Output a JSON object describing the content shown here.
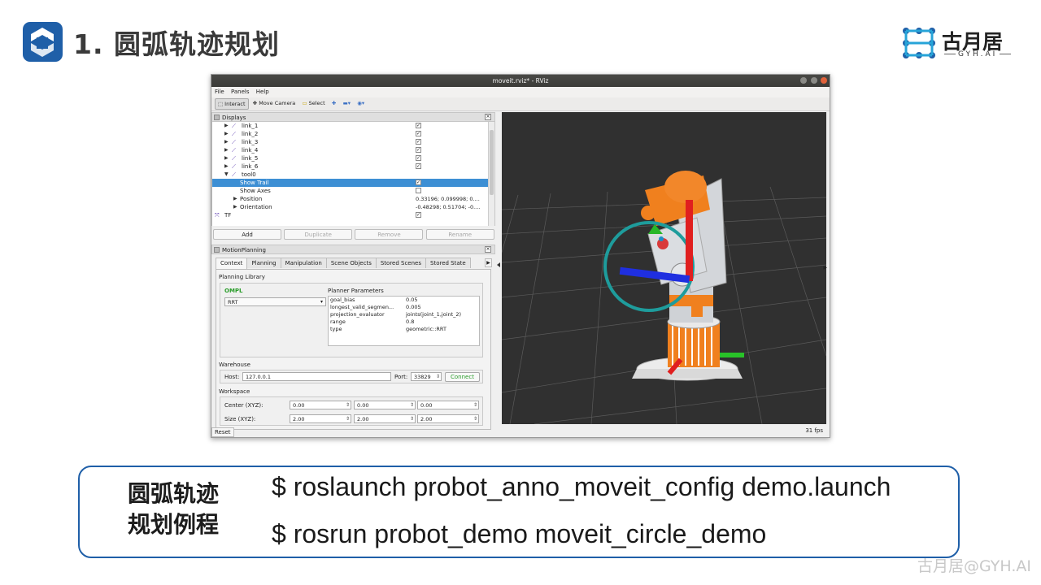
{
  "slide": {
    "title": "1. 圆弧轨迹规划",
    "brand_name": "古月居",
    "brand_sub": "GYH.AI",
    "watermark": "古月居@GYH.AI",
    "accent_color": "#1f5fa8"
  },
  "window": {
    "title": "moveit.rviz* - RViz",
    "menu": [
      "File",
      "Panels",
      "Help"
    ],
    "toolbar": {
      "interact": "Interact",
      "move_camera": "Move Camera",
      "select": "Select"
    },
    "fps": "31 fps",
    "reset": "Reset"
  },
  "displays": {
    "title": "Displays",
    "rows": [
      {
        "label": "link_1",
        "check": "✓"
      },
      {
        "label": "link_2",
        "check": "✓"
      },
      {
        "label": "link_3",
        "check": "✓"
      },
      {
        "label": "link_4",
        "check": "✓"
      },
      {
        "label": "link_5",
        "check": "✓"
      },
      {
        "label": "link_6",
        "check": "✓"
      },
      {
        "label": "tool0",
        "check": ""
      },
      {
        "label": "Show Trail",
        "check": "✓"
      },
      {
        "label": "Show Axes",
        "check": ""
      },
      {
        "label": "Position",
        "value": "0.33196; 0.099998; 0...."
      },
      {
        "label": "Orientation",
        "value": "-0.48298; 0.51704; -0...."
      },
      {
        "label": "TF",
        "check": "✓"
      }
    ],
    "buttons": [
      "Add",
      "Duplicate",
      "Remove",
      "Rename"
    ]
  },
  "motion": {
    "title": "MotionPlanning",
    "tabs": [
      "Context",
      "Planning",
      "Manipulation",
      "Scene Objects",
      "Stored Scenes",
      "Stored State"
    ],
    "planning_library": "Planning Library",
    "ompl": "OMPL",
    "planner": "RRT",
    "planner_params_title": "Planner Parameters",
    "params": [
      {
        "k": "goal_bias",
        "v": "0.05"
      },
      {
        "k": "longest_valid_segmen...",
        "v": "0.005"
      },
      {
        "k": "projection_evaluator",
        "v": "joints(joint_1,joint_2)"
      },
      {
        "k": "range",
        "v": "0.8"
      },
      {
        "k": "type",
        "v": "geometric::RRT"
      }
    ],
    "warehouse": "Warehouse",
    "host_label": "Host:",
    "host": "127.0.0.1",
    "port_label": "Port:",
    "port": "33829",
    "connect": "Connect",
    "workspace": "Workspace",
    "center_label": "Center (XYZ):",
    "center": [
      "0.00",
      "0.00",
      "0.00"
    ],
    "size_label": "Size (XYZ):",
    "size": [
      "2.00",
      "2.00",
      "2.00"
    ]
  },
  "commands": {
    "label": "圆弧轨迹规划例程",
    "label_line1": "圆弧轨迹",
    "label_line2": "规划例程",
    "cmd1": "$ roslaunch probot_anno_moveit_config demo.launch",
    "cmd2": "$ rosrun probot_demo moveit_circle_demo"
  }
}
